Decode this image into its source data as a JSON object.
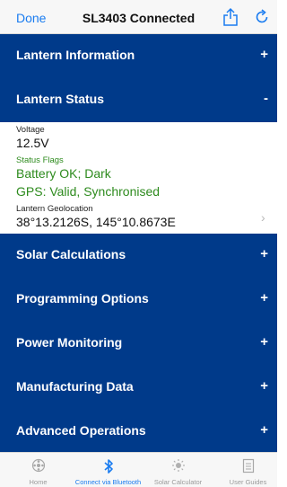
{
  "nav": {
    "done": "Done",
    "title": "SL3403 Connected",
    "share_icon": "share-icon",
    "refresh_icon": "refresh-icon"
  },
  "sections": {
    "lantern_information": {
      "label": "Lantern Information",
      "toggle": "+"
    },
    "lantern_status": {
      "label": "Lantern Status",
      "toggle": "-"
    },
    "solar_calculations": {
      "label": "Solar Calculations",
      "toggle": "+"
    },
    "programming_options": {
      "label": "Programming Options",
      "toggle": "+"
    },
    "power_monitoring": {
      "label": "Power Monitoring",
      "toggle": "+"
    },
    "manufacturing_data": {
      "label": "Manufacturing Data",
      "toggle": "+"
    },
    "advanced_operations": {
      "label": "Advanced Operations",
      "toggle": "+"
    }
  },
  "status": {
    "voltage_label": "Voltage",
    "voltage_value": "12.5V",
    "flags_label": "Status Flags",
    "flag_1": "Battery OK; Dark",
    "flag_2": "GPS: Valid, Synchronised",
    "geo_label": "Lantern Geolocation",
    "geo_value": "38°13.2126S, 145°10.8673E",
    "chevron": "›"
  },
  "tabs": [
    {
      "label": "Home",
      "icon": "home-icon",
      "active": false
    },
    {
      "label": "Connect via Bluetooth",
      "icon": "bluetooth-icon",
      "active": true
    },
    {
      "label": "Solar Calculator",
      "icon": "sun-icon",
      "active": false
    },
    {
      "label": "User Guides",
      "icon": "document-icon",
      "active": false
    }
  ],
  "colors": {
    "section_bg": "#003a8a",
    "accent": "#1a7cf0",
    "status_green": "#2e8b1e"
  }
}
